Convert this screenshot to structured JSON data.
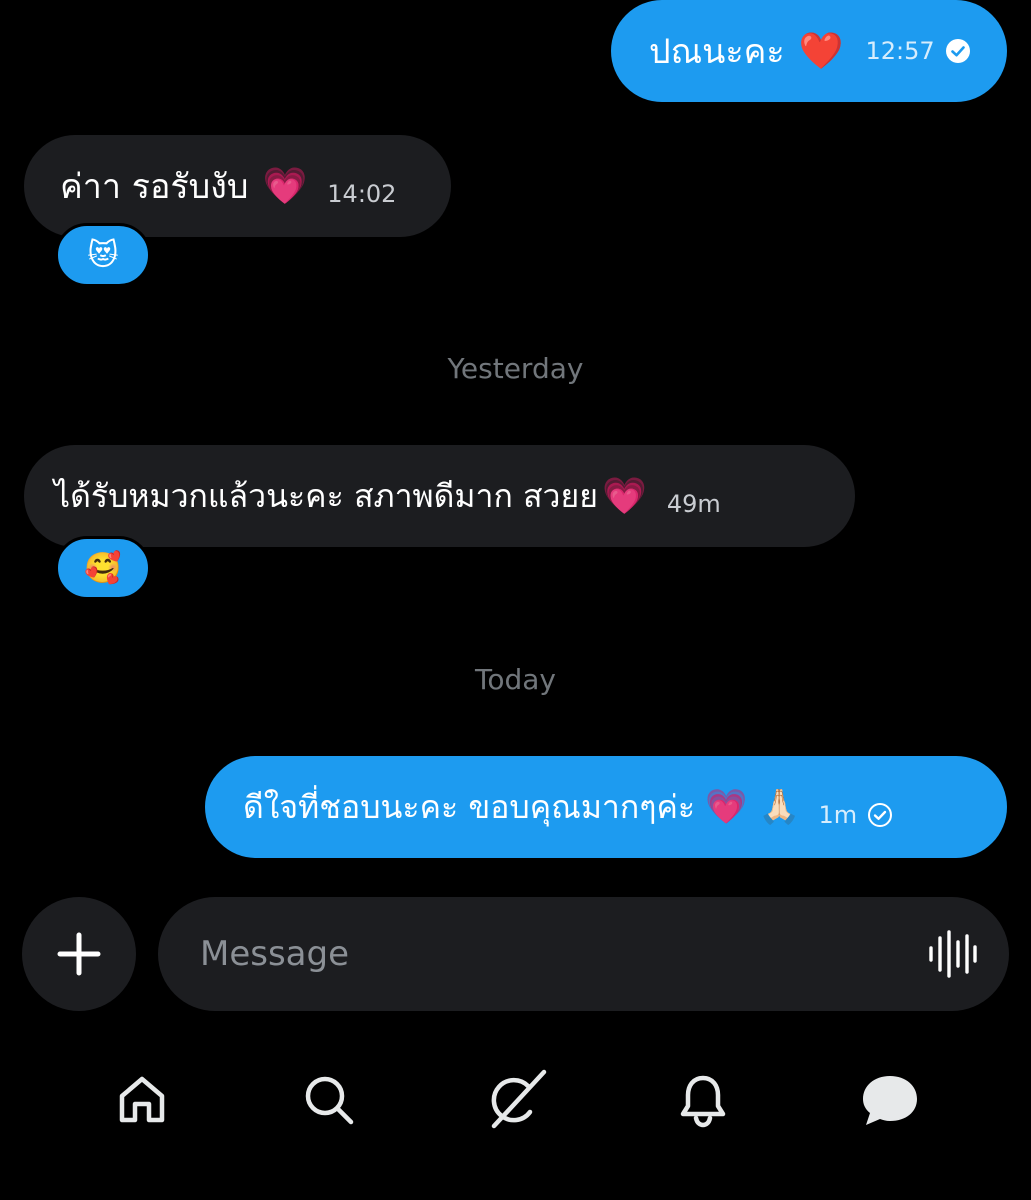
{
  "messages": [
    {
      "direction": "out",
      "text": "ปณนะคะ",
      "emoji": "❤️",
      "time": "12:57",
      "status_icon": "sent-check-icon"
    },
    {
      "direction": "in",
      "text": "ค่าา รอรับงับ",
      "emoji": "💗",
      "time": "14:02",
      "reaction": "😻"
    },
    {
      "direction": "in",
      "text": "ได้รับหมวกแล้วนะคะ สภาพดีมาก สวยย",
      "emoji": "💗",
      "time": "49m",
      "reaction": "🥰"
    },
    {
      "direction": "out",
      "text": "ดีใจที่ชอบนะคะ ขอบคุณมากๆค่ะ",
      "emoji": "💗 🙏🏻",
      "time": "1m",
      "status_icon": "sent-check-icon"
    }
  ],
  "separators": {
    "yesterday": "Yesterday",
    "today": "Today"
  },
  "composer": {
    "placeholder": "Message",
    "value": ""
  },
  "nav": [
    "home-icon",
    "search-icon",
    "grok-icon",
    "notifications-icon",
    "messages-icon"
  ],
  "colors": {
    "background": "#000000",
    "accent": "#1d9bf0",
    "incoming_bubble": "#1c1d20",
    "muted_text": "#71767b"
  }
}
